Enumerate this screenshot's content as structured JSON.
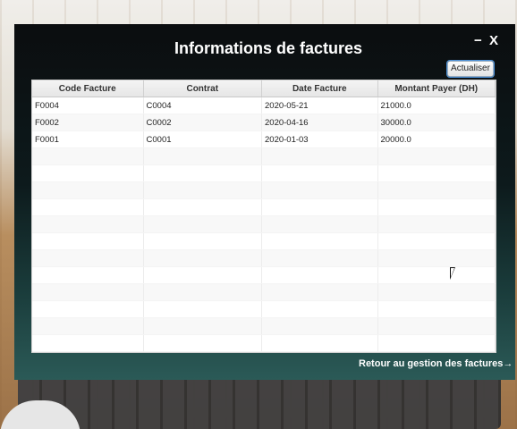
{
  "window": {
    "title": "Informations de factures",
    "minimize_label": "−",
    "close_label": "X"
  },
  "toolbar": {
    "refresh_label": "Actualiser"
  },
  "table": {
    "columns": [
      "Code Facture",
      "Contrat",
      "Date Facture",
      "Montant Payer (DH)"
    ],
    "rows": [
      [
        "F0004",
        "C0004",
        "2020-05-21",
        "21000.0"
      ],
      [
        "F0002",
        "C0002",
        "2020-04-16",
        "30000.0"
      ],
      [
        "F0001",
        "C0001",
        "2020-01-03",
        "20000.0"
      ]
    ],
    "empty_row_count": 12
  },
  "footer": {
    "back_label": "Retour au gestion des factures→"
  },
  "colors": {
    "title_text": "#ffffff",
    "window_bg_top": "#0b0d0f",
    "window_bg_bottom": "#2b5a57",
    "button_focus": "#4a90d9"
  }
}
